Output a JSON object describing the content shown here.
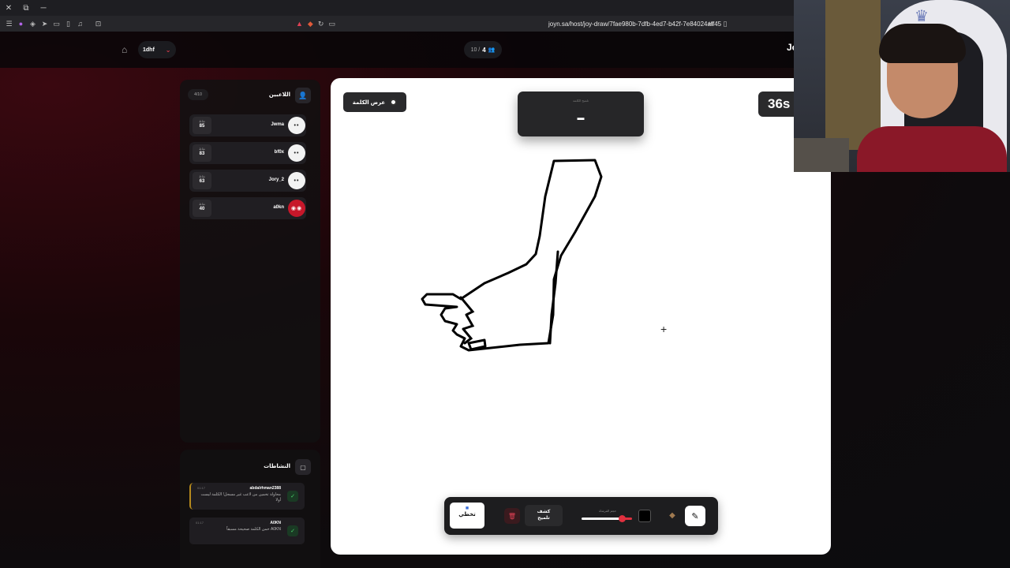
{
  "browser": {
    "url": "joyn.sa/host/joy-draw/7fae980b-7dfb-4ed7-b42f-7e84024aff45"
  },
  "topnav": {
    "room_code": "1dhf",
    "players_current": "4",
    "players_max": "10 /",
    "brand": "Joy"
  },
  "players_panel": {
    "title": "اللاعبين",
    "count": "4/10",
    "score_label": "نقاط",
    "players": [
      {
        "name": "Jwma",
        "score": "85"
      },
      {
        "name": "bf0x",
        "score": "83"
      },
      {
        "name": "Jory_2",
        "score": "63"
      },
      {
        "name": "a0kn",
        "score": "40"
      }
    ]
  },
  "activity_panel": {
    "title": "النشاطات",
    "items": [
      {
        "time": "01:17",
        "user": "abdalrhman2388",
        "text": "محاولة تخمين من لاعب غير مسجل! الكلمة ليست أولا"
      },
      {
        "time": "01:17",
        "user": "A0KN",
        "text": "A0KN خمن الكلمة صحيحة مسبقاً"
      }
    ]
  },
  "canvas": {
    "show_word_label": "عرض الكلمة",
    "word_label": "تلميح الكلمة",
    "word_blank": "▬",
    "timer": "36s"
  },
  "toolbox": {
    "skip_label": "تخطي",
    "hint_label_line1": "كشف",
    "hint_label_line2": "تلميح",
    "size_label": "حجم الفرشاة",
    "size_value": 0.8,
    "color": "#000000"
  },
  "colors": {
    "accent": "#e0303f",
    "panel": "#121012",
    "canvas": "#ffffff"
  }
}
